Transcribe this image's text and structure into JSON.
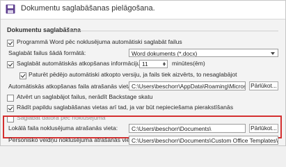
{
  "header": {
    "title": "Dokumentu saglabāšanas pielāgošana.",
    "icon": "floppy-disk-icon",
    "icon_color": "#5b3b8c"
  },
  "section": {
    "title": "Dokumentu saglabāšana"
  },
  "options": {
    "save_in_format": {
      "label": "Programmā Word pēc noklusējuma automātiski saglabāt failus",
      "checked": true
    },
    "file_format": {
      "label": "Saglabāt failus šādā formātā:",
      "value": "Word dokuments (*.docx)"
    },
    "autorecover": {
      "label": "Saglabāt automātiskās atkopšanas informāciju ik pēc",
      "checked": true,
      "minutes_value": "11",
      "minutes_label": "minūtes(ēm)"
    },
    "keep_last": {
      "label": "Paturēt pēdējo automātiski atkopto versiju, ja fails tiek aizvērts, to nesaglabājot",
      "checked": true
    },
    "autorecover_location": {
      "label": "Automātiskās atkopšanas faila atrašanās vieta:",
      "value": "C:\\Users\\beschorr\\AppData\\Roaming\\Microsoft",
      "browse_label": "Pārlūkot..."
    },
    "no_backstage": {
      "label": "Atvērt un saglabājot failus, nerādīt Backstage skatu",
      "checked": false
    },
    "show_more_places": {
      "label": "Rādīt papildu saglabāšanas vietas arī tad, ja var būt nepieciešama pierakstīšanās",
      "checked": true
    },
    "save_to_computer": {
      "label": "Saglabāt datorā pēc noklusējuma",
      "checked": false
    },
    "default_local": {
      "label": "Lokālā faila noklusējuma atrašanās vieta:",
      "value": "C:\\Users\\beschorr\\Documents\\",
      "browse_label": "Pārlūkot..."
    },
    "personal_templates": {
      "label": "Personisko veidņu noklusējuma atrašanās vieta:",
      "value": "C:\\Users\\beschorr\\Documents\\Custom Office Templates\\"
    }
  },
  "colors": {
    "highlight": "#d42f2f"
  }
}
